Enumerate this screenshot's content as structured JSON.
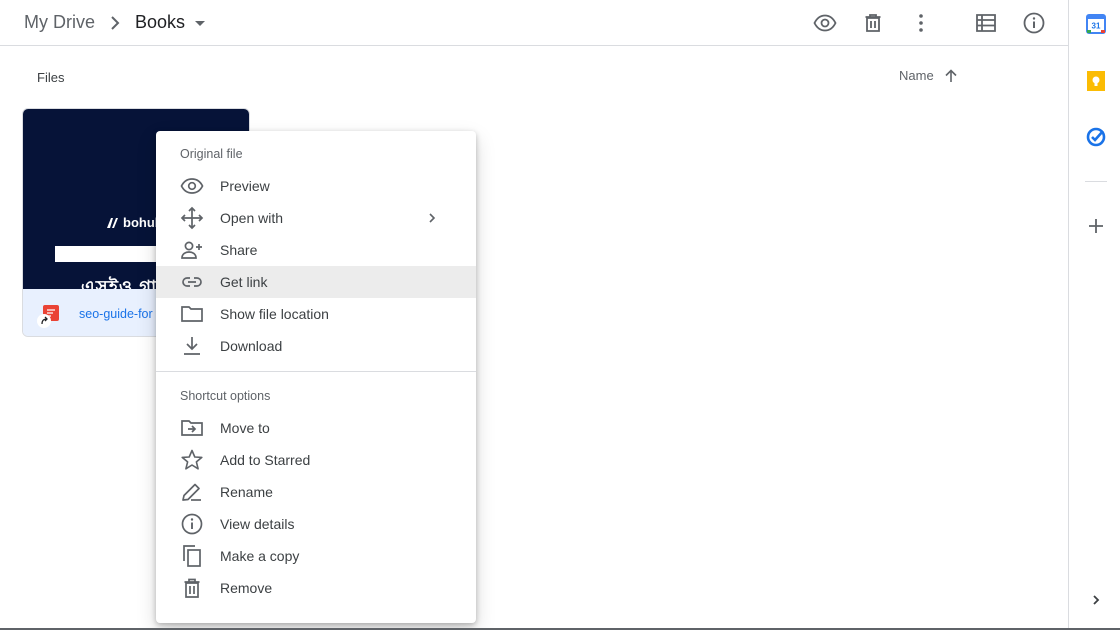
{
  "breadcrumb": {
    "root": "My Drive",
    "current": "Books"
  },
  "header": {
    "actions": [
      {
        "name": "preview-icon"
      },
      {
        "name": "trash-icon"
      },
      {
        "name": "more-vert-icon"
      },
      {
        "name": "list-view-icon"
      },
      {
        "name": "info-icon"
      }
    ]
  },
  "files": {
    "section_label": "Files",
    "sort_label": "Name",
    "sort_direction": "ascending"
  },
  "file_card": {
    "name": "seo-guide-for",
    "type": "pdf",
    "thumbnail_brand": "bohubri",
    "thumbnail_text": "এসইও গাই"
  },
  "context_menu": {
    "section1_title": "Original file",
    "section1_items": [
      {
        "label": "Preview",
        "icon": "eye-icon"
      },
      {
        "label": "Open with",
        "icon": "move-arrows-icon",
        "submenu": true
      },
      {
        "label": "Share",
        "icon": "person-add-icon"
      },
      {
        "label": "Get link",
        "icon": "link-icon",
        "highlighted": true
      },
      {
        "label": "Show file location",
        "icon": "folder-icon"
      },
      {
        "label": "Download",
        "icon": "download-icon"
      }
    ],
    "section2_title": "Shortcut options",
    "section2_items": [
      {
        "label": "Move to",
        "icon": "move-to-folder-icon"
      },
      {
        "label": "Add to Starred",
        "icon": "star-icon"
      },
      {
        "label": "Rename",
        "icon": "pencil-icon"
      },
      {
        "label": "View details",
        "icon": "info-icon"
      },
      {
        "label": "Make a copy",
        "icon": "copy-icon"
      },
      {
        "label": "Remove",
        "icon": "trash-icon"
      }
    ]
  },
  "side_rail": {
    "apps": [
      {
        "name": "calendar-icon",
        "label": "31",
        "color": "#1a73e8"
      },
      {
        "name": "keep-icon",
        "color": "#fbbc04"
      },
      {
        "name": "tasks-icon",
        "color": "#1a73e8"
      }
    ]
  }
}
